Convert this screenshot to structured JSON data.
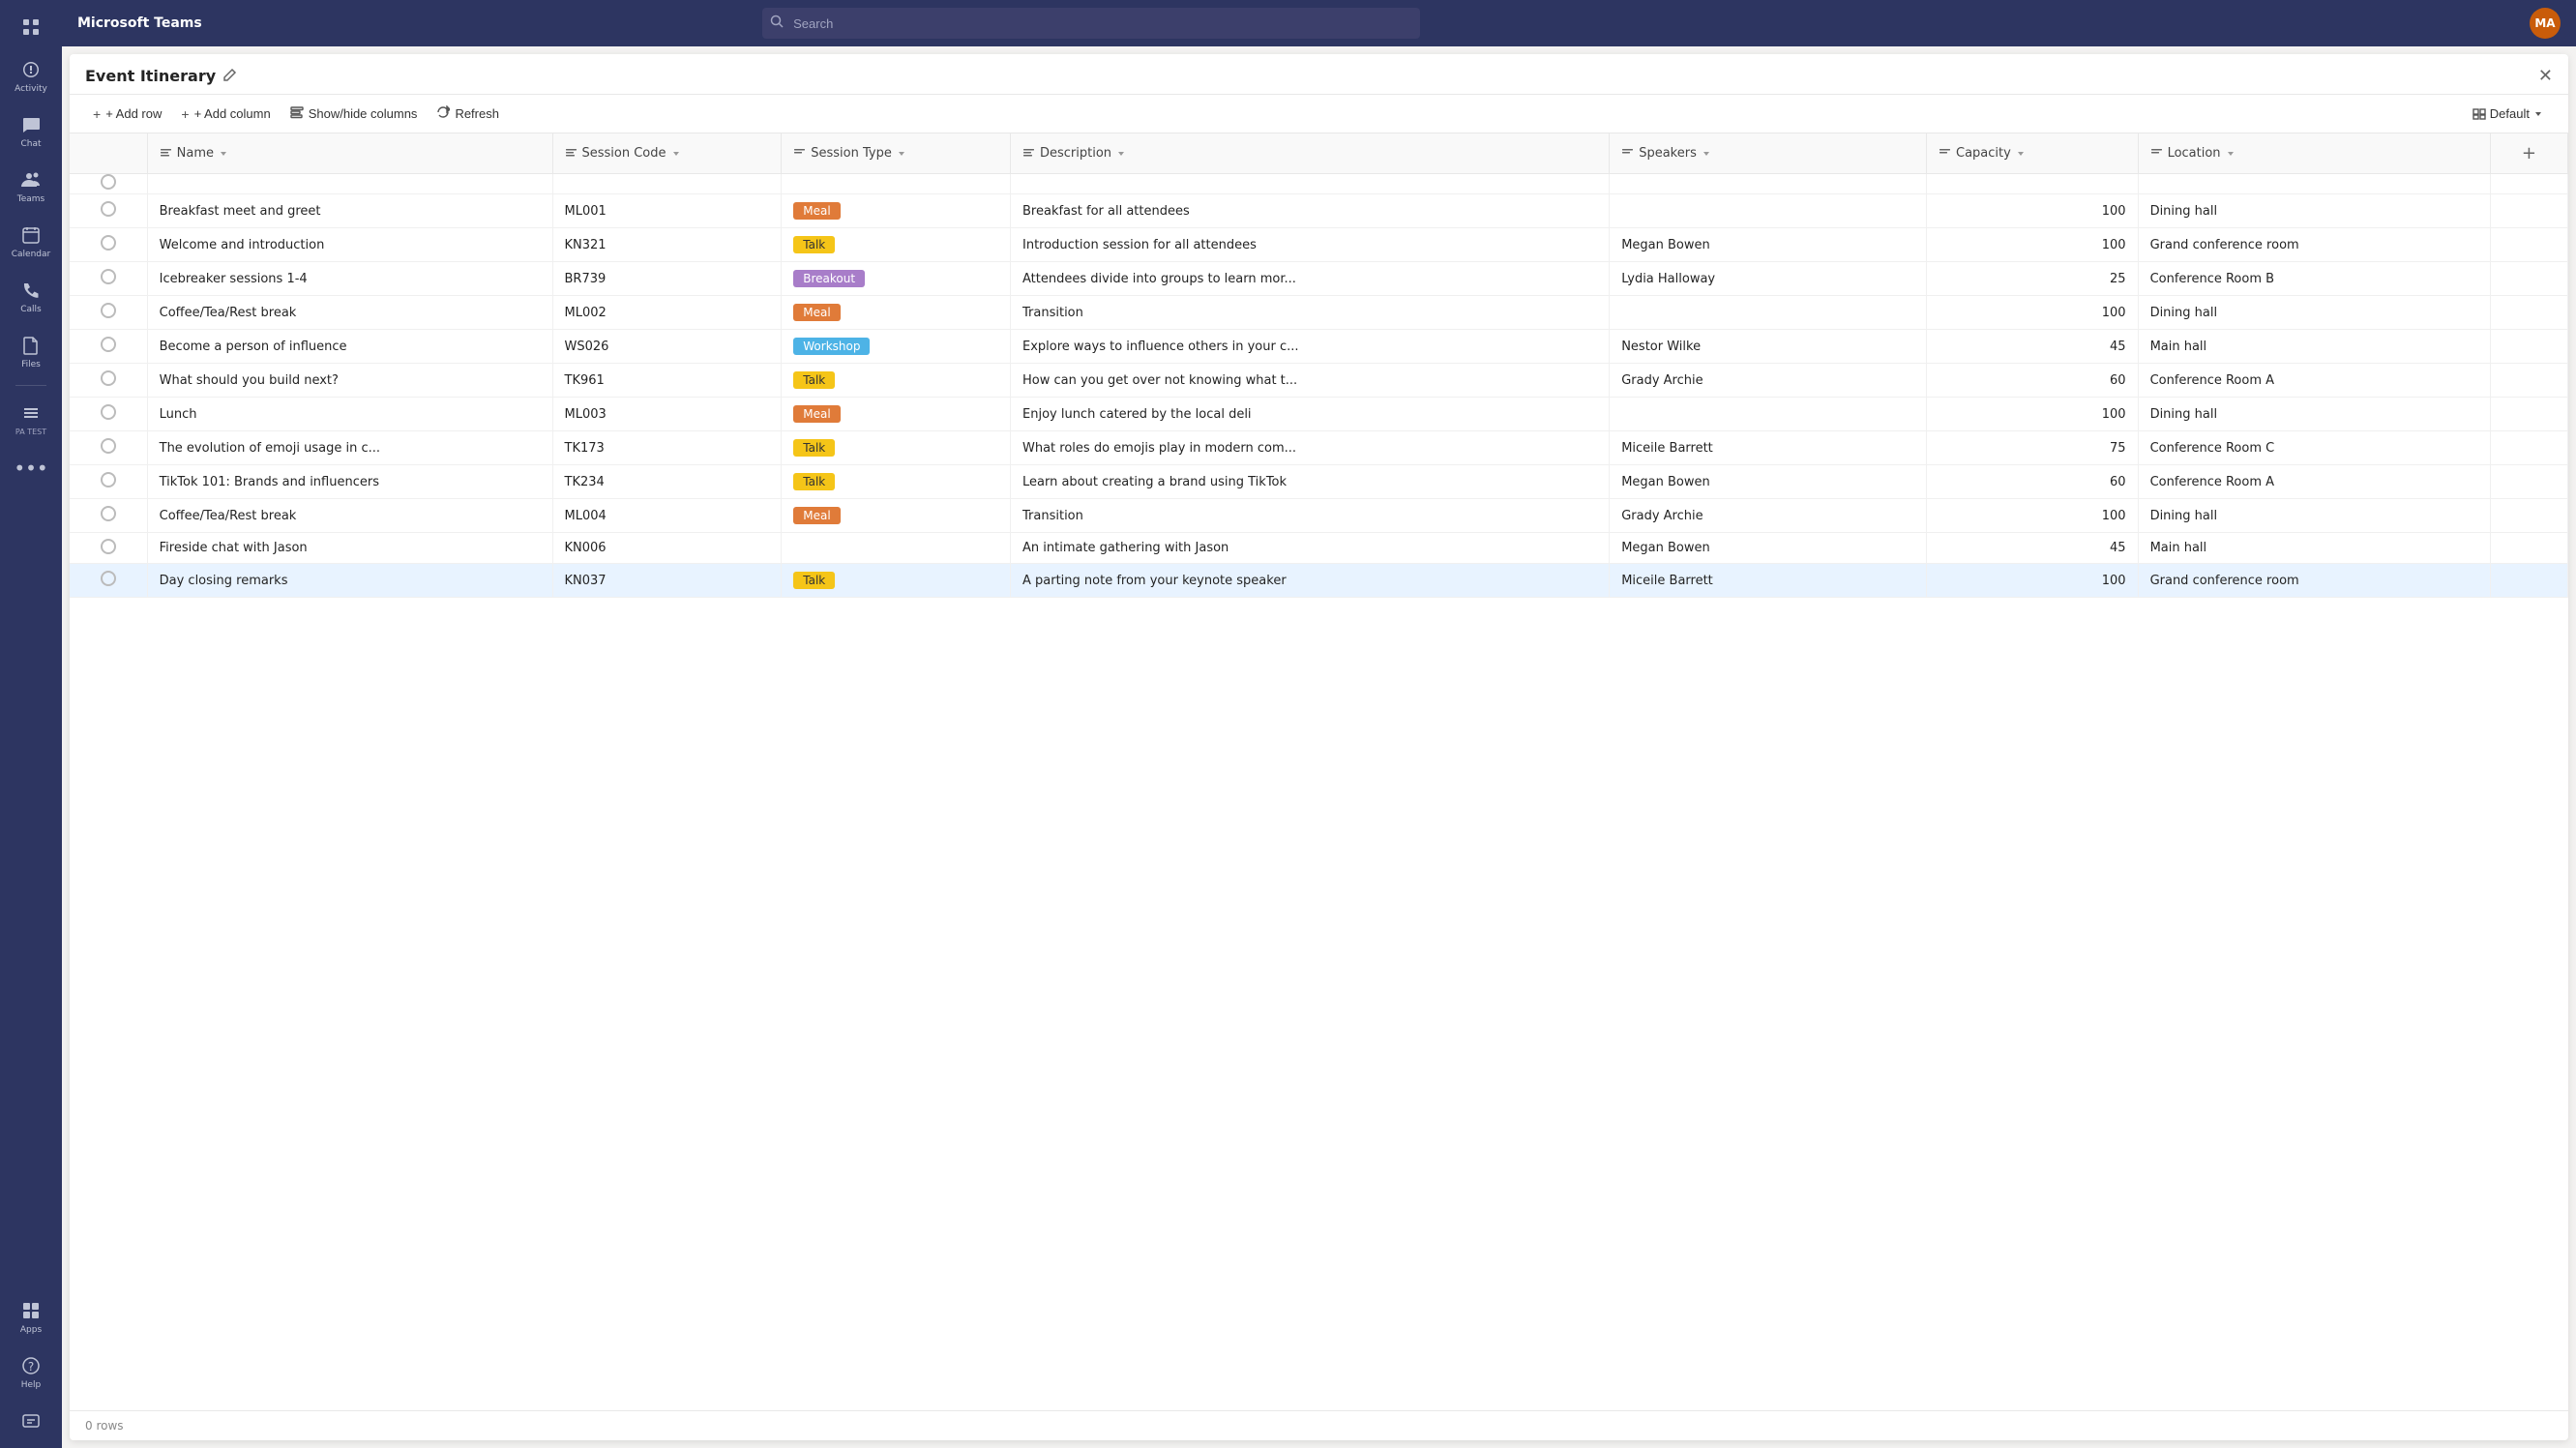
{
  "app": {
    "title": "Microsoft Teams",
    "search_placeholder": "Search",
    "avatar_initials": "MA"
  },
  "sidebar": {
    "items": [
      {
        "id": "apps-grid",
        "label": "",
        "icon": "⊞",
        "active": false
      },
      {
        "id": "activity",
        "label": "Activity",
        "icon": "🔔",
        "active": false
      },
      {
        "id": "chat",
        "label": "Chat",
        "icon": "💬",
        "active": false
      },
      {
        "id": "teams",
        "label": "Teams",
        "icon": "👥",
        "active": false
      },
      {
        "id": "calendar",
        "label": "Calendar",
        "icon": "📅",
        "active": false
      },
      {
        "id": "calls",
        "label": "Calls",
        "icon": "📞",
        "active": false
      },
      {
        "id": "files",
        "label": "Files",
        "icon": "📄",
        "active": false
      },
      {
        "id": "pa-test",
        "label": "PA TEST",
        "icon": "🔧",
        "active": false
      }
    ],
    "bottom_items": [
      {
        "id": "apps",
        "label": "Apps",
        "icon": "🧩"
      },
      {
        "id": "help",
        "label": "Help",
        "icon": "❓"
      },
      {
        "id": "feedback",
        "label": "",
        "icon": "⬛"
      }
    ]
  },
  "panel": {
    "title": "Event Itinerary",
    "toolbar": {
      "add_row": "+ Add row",
      "add_column": "+ Add column",
      "show_hide": "Show/hide columns",
      "refresh": "Refresh",
      "default": "Default"
    },
    "columns": [
      {
        "id": "name",
        "label": "Name",
        "has_sort": true
      },
      {
        "id": "session_code",
        "label": "Session Code",
        "has_sort": true
      },
      {
        "id": "session_type",
        "label": "Session Type",
        "has_sort": true
      },
      {
        "id": "description",
        "label": "Description",
        "has_sort": true
      },
      {
        "id": "speakers",
        "label": "Speakers",
        "has_sort": true
      },
      {
        "id": "capacity",
        "label": "Capacity",
        "has_sort": true
      },
      {
        "id": "location",
        "label": "Location",
        "has_sort": true
      }
    ],
    "rows": [
      {
        "name": "Breakfast meet and greet",
        "session_code": "ML001",
        "session_type": "Meal",
        "session_type_class": "badge-meal",
        "description": "Breakfast for all attendees",
        "speakers": "",
        "capacity": "100",
        "location": "Dining hall"
      },
      {
        "name": "Welcome and introduction",
        "session_code": "KN321",
        "session_type": "Talk",
        "session_type_class": "badge-talk",
        "description": "Introduction session for all attendees",
        "speakers": "Megan Bowen",
        "capacity": "100",
        "location": "Grand conference room"
      },
      {
        "name": "Icebreaker sessions 1-4",
        "session_code": "BR739",
        "session_type": "Breakout",
        "session_type_class": "badge-breakout",
        "description": "Attendees divide into groups to learn mor...",
        "speakers": "Lydia Halloway",
        "capacity": "25",
        "location": "Conference Room B"
      },
      {
        "name": "Coffee/Tea/Rest break",
        "session_code": "ML002",
        "session_type": "Meal",
        "session_type_class": "badge-meal",
        "description": "Transition",
        "speakers": "",
        "capacity": "100",
        "location": "Dining hall"
      },
      {
        "name": "Become a person of influence",
        "session_code": "WS026",
        "session_type": "Workshop",
        "session_type_class": "badge-workshop",
        "description": "Explore ways to influence others in your c...",
        "speakers": "Nestor Wilke",
        "capacity": "45",
        "location": "Main hall"
      },
      {
        "name": "What should you build next?",
        "session_code": "TK961",
        "session_type": "Talk",
        "session_type_class": "badge-talk",
        "description": "How can you get over not knowing what t...",
        "speakers": "Grady Archie",
        "capacity": "60",
        "location": "Conference Room A"
      },
      {
        "name": "Lunch",
        "session_code": "ML003",
        "session_type": "Meal",
        "session_type_class": "badge-meal",
        "description": "Enjoy lunch catered by the local deli",
        "speakers": "",
        "capacity": "100",
        "location": "Dining hall"
      },
      {
        "name": "The evolution of emoji usage in c...",
        "session_code": "TK173",
        "session_type": "Talk",
        "session_type_class": "badge-talk",
        "description": "What roles do emojis play in modern com...",
        "speakers": "Miceile Barrett",
        "capacity": "75",
        "location": "Conference Room C"
      },
      {
        "name": "TikTok 101: Brands and influencers",
        "session_code": "TK234",
        "session_type": "Talk",
        "session_type_class": "badge-talk",
        "description": "Learn about creating a brand using TikTok",
        "speakers": "Megan Bowen",
        "capacity": "60",
        "location": "Conference Room A"
      },
      {
        "name": "Coffee/Tea/Rest break",
        "session_code": "ML004",
        "session_type": "Meal",
        "session_type_class": "badge-meal",
        "description": "Transition",
        "speakers": "Grady Archie",
        "capacity": "100",
        "location": "Dining hall"
      },
      {
        "name": "Fireside chat with Jason",
        "session_code": "KN006",
        "session_type": "",
        "session_type_class": "",
        "description": "An intimate gathering with Jason",
        "speakers": "Megan Bowen",
        "capacity": "45",
        "location": "Main hall"
      },
      {
        "name": "Day closing remarks",
        "session_code": "KN037",
        "session_type": "Talk",
        "session_type_class": "badge-talk",
        "description": "A parting note from your keynote speaker",
        "speakers": "Miceile Barrett",
        "capacity": "100",
        "location": "Grand conference room"
      }
    ],
    "footer": "0 rows"
  }
}
